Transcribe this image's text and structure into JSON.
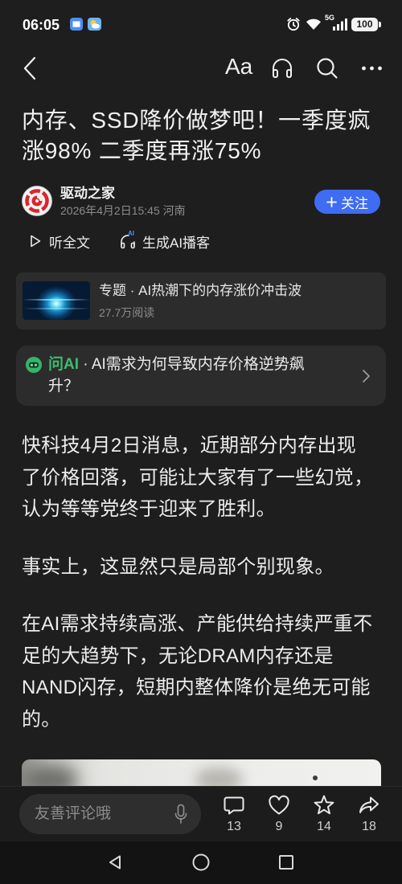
{
  "status_bar": {
    "time": "06:05",
    "network": "5G",
    "battery": "100",
    "icons": [
      "book-app-icon",
      "weather-app-icon",
      "alarm-icon",
      "wifi-icon",
      "signal-icon",
      "battery-icon"
    ]
  },
  "toolbar": {
    "font_size_label": "Aa",
    "icons": [
      "back-icon",
      "headphones-icon",
      "search-icon",
      "more-icon"
    ]
  },
  "article": {
    "title_lines": [
      "内存、SSD降价做梦吧！一季度疯",
      "涨98% 二季度再涨75%"
    ],
    "author": {
      "name": "驱动之家",
      "meta": "2026年4月2日15:45 河南",
      "follow_label": "关注"
    },
    "actions": {
      "listen_label": "听全文",
      "podcast_label": "生成AI播客",
      "podcast_badge": "AI"
    },
    "topic": {
      "label": "专题 · AI热潮下的内存涨价冲击波",
      "reads": "27.7万阅读"
    },
    "ask_ai": {
      "brand": "问AI",
      "question_lines": [
        " · AI需求为何导致内存价格逆势飙",
        "升？"
      ]
    },
    "paragraphs": [
      {
        "lines": [
          "快科技4月2日消息，近期部分内存出现",
          "了价格回落，可能让大家有了一些幻觉，",
          "认为等等党终于迎来了胜利。"
        ]
      },
      {
        "lines": [
          "事实上，这显然只是局部个别现象。"
        ]
      },
      {
        "lines": [
          "在AI需求持续高涨、产能供给持续严重不",
          "足的大趋势下，无论DRAM内存还是",
          "NAND闪存，短期内整体降价是绝无可能",
          "的。"
        ]
      }
    ]
  },
  "bottom_bar": {
    "comment_placeholder": "友善评论哦",
    "comment_count": "13",
    "like_count": "9",
    "favorite_count": "14",
    "share_count": "18"
  },
  "colors": {
    "bg": "#1e1e1e",
    "card": "#2c2c2c",
    "text": "#ececec",
    "muted": "#8c8c8c",
    "accent": "#3f6cf3",
    "green": "#3dbd6b"
  }
}
